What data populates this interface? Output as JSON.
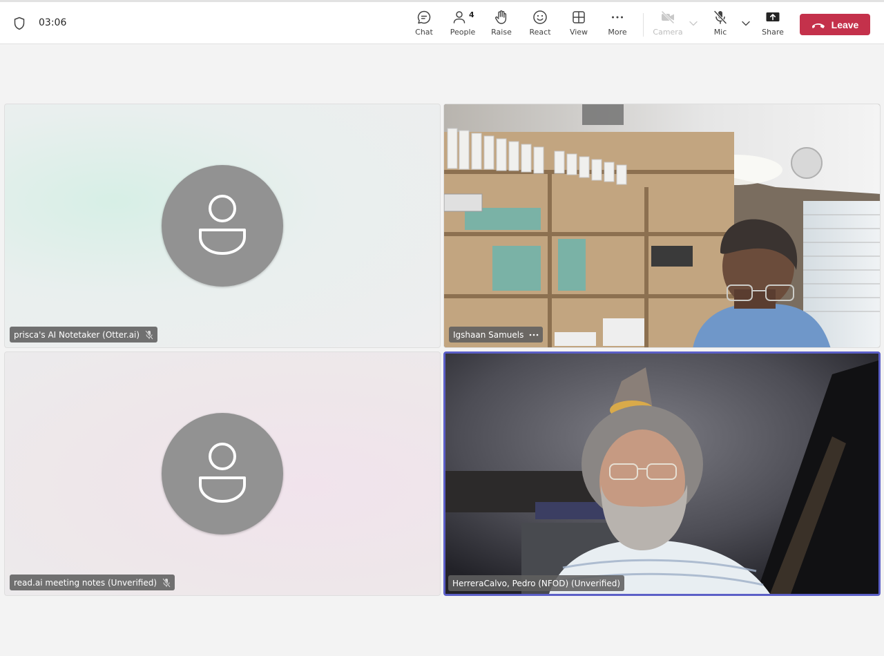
{
  "header": {
    "timer": "03:06",
    "shield_icon": "shield-icon"
  },
  "toolbar": {
    "chat_label": "Chat",
    "people_label": "People",
    "people_count": "4",
    "raise_label": "Raise",
    "react_label": "React",
    "view_label": "View",
    "more_label": "More",
    "camera_label": "Camera",
    "mic_label": "Mic",
    "share_label": "Share",
    "leave_label": "Leave"
  },
  "participants": [
    {
      "name": "prisca's AI Notetaker (Otter.ai)",
      "muted": true,
      "video": false
    },
    {
      "name": "Igshaan Samuels",
      "muted": false,
      "video": true
    },
    {
      "name": "read.ai meeting notes (Unverified)",
      "muted": true,
      "video": false
    },
    {
      "name": "HerreraCalvo, Pedro (NFOD) (Unverified)",
      "muted": false,
      "video": true,
      "active_speaker": true
    }
  ],
  "colors": {
    "leave_button": "#c4314b",
    "active_speaker_border": "#5b5fc7",
    "avatar_bg": "#929292"
  }
}
